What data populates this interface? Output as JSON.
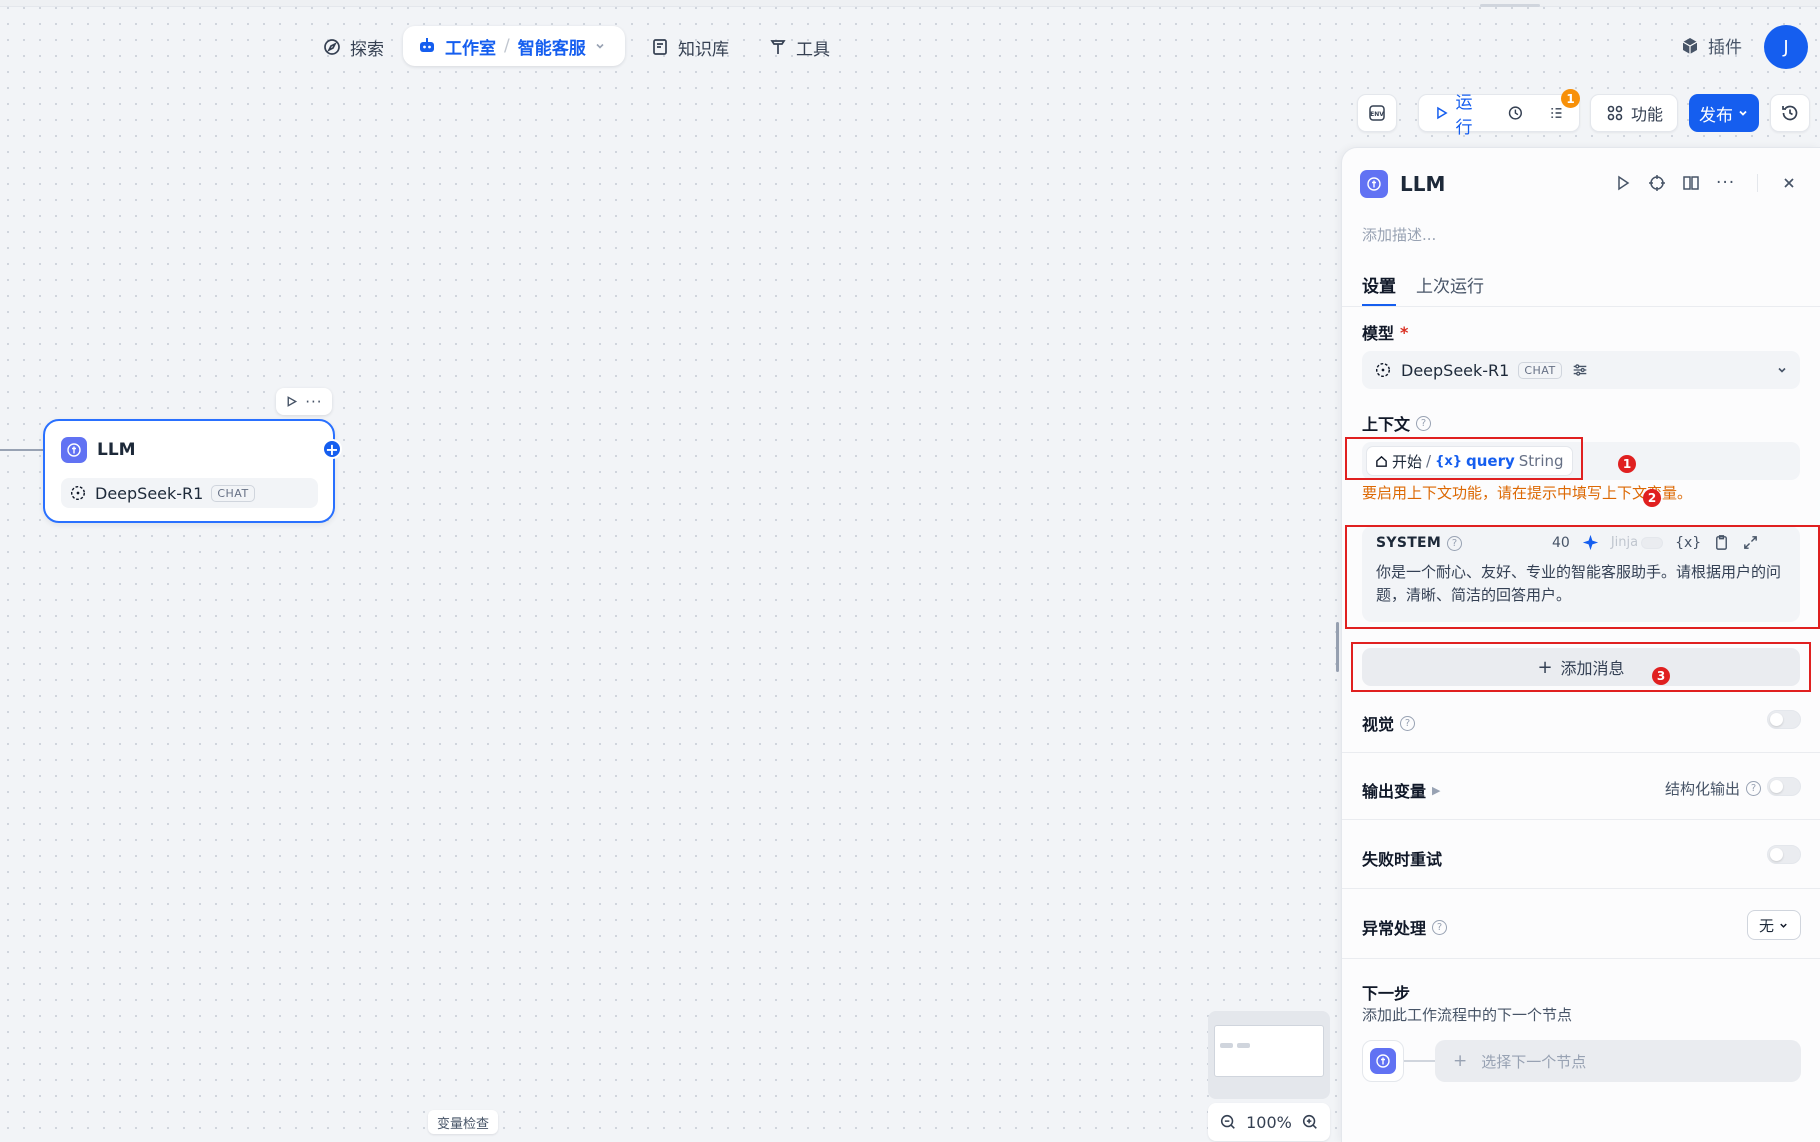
{
  "nav": {
    "explore": "探索",
    "studio": "工作室",
    "app_name": "智能客服",
    "knowledge": "知识库",
    "tools": "工具",
    "plugins": "插件",
    "avatar_initial": "J"
  },
  "toolbar": {
    "env": "ENV",
    "run": "运行",
    "checklist_badge": "1",
    "features": "功能",
    "publish": "发布"
  },
  "canvas": {
    "node": {
      "title": "LLM",
      "model": "DeepSeek-R1",
      "model_tag": "CHAT"
    },
    "variable_inspect": "变量检查",
    "zoom": "100%"
  },
  "panel": {
    "title": "LLM",
    "description_placeholder": "添加描述...",
    "tabs": [
      {
        "label": "设置"
      },
      {
        "label": "上次运行"
      }
    ],
    "model": {
      "label": "模型",
      "required": "*",
      "name": "DeepSeek-R1",
      "tag": "CHAT"
    },
    "context": {
      "label": "上下文",
      "node": "开始",
      "separator": "/",
      "var_icon": "{x}",
      "var_name": "query",
      "var_type": "String",
      "warning": "要启用上下文功能，请在提示中填写上下文变量。"
    },
    "system": {
      "label": "SYSTEM",
      "count": "40",
      "jinja": "Jinja",
      "var_icon": "{x}",
      "text": "你是一个耐心、友好、专业的智能客服助手。请根据用户的问题，清晰、简洁的回答用户。"
    },
    "add_message": "添加消息",
    "vision": "视觉",
    "output_vars": "输出变量",
    "structured_output": "结构化输出",
    "retry": "失败时重试",
    "error_handling": {
      "label": "异常处理",
      "value": "无"
    },
    "next_step": {
      "label": "下一步",
      "desc": "添加此工作流程中的下一个节点",
      "select": "选择下一个节点"
    }
  },
  "annotations": [
    "1",
    "2",
    "3"
  ],
  "colors": {
    "accent": "#155eef",
    "warning": "#dc6803",
    "annotation": "#e02020",
    "llm_icon": "#6172f3"
  }
}
